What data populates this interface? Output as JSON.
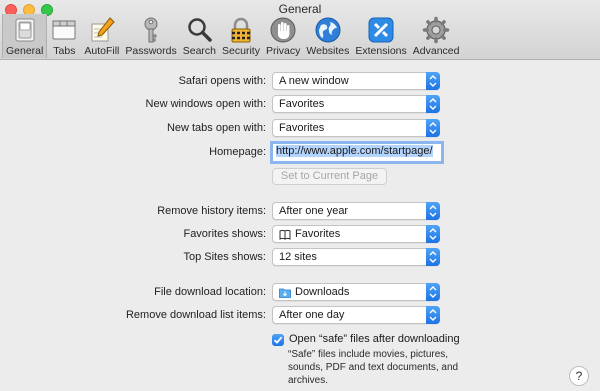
{
  "window": {
    "title": "General"
  },
  "toolbar": {
    "tabs": [
      {
        "label": "General",
        "icon": "general-switch-icon",
        "selected": true
      },
      {
        "label": "Tabs",
        "icon": "tabs-window-icon",
        "selected": false
      },
      {
        "label": "AutoFill",
        "icon": "pencil-form-icon",
        "selected": false
      },
      {
        "label": "Passwords",
        "icon": "key-icon",
        "selected": false
      },
      {
        "label": "Search",
        "icon": "magnifier-icon",
        "selected": false
      },
      {
        "label": "Security",
        "icon": "padlock-icon",
        "selected": false
      },
      {
        "label": "Privacy",
        "icon": "hand-icon",
        "selected": false
      },
      {
        "label": "Websites",
        "icon": "globe-icon",
        "selected": false
      },
      {
        "label": "Extensions",
        "icon": "puzzle-icon",
        "selected": false
      },
      {
        "label": "Advanced",
        "icon": "gear-icon",
        "selected": false
      }
    ]
  },
  "form": {
    "safari_opens_with": {
      "label": "Safari opens with:",
      "value": "A new window"
    },
    "new_windows_open_with": {
      "label": "New windows open with:",
      "value": "Favorites"
    },
    "new_tabs_open_with": {
      "label": "New tabs open with:",
      "value": "Favorites"
    },
    "homepage": {
      "label": "Homepage:",
      "value": "http://www.apple.com/startpage/"
    },
    "set_current_page_button": "Set to Current Page",
    "remove_history": {
      "label": "Remove history items:",
      "value": "After one year"
    },
    "favorites_shows": {
      "label": "Favorites shows:",
      "value": "Favorites"
    },
    "top_sites_shows": {
      "label": "Top Sites shows:",
      "value": "12 sites"
    },
    "file_download_location": {
      "label": "File download location:",
      "value": "Downloads"
    },
    "remove_download_items": {
      "label": "Remove download list items:",
      "value": "After one day"
    },
    "open_safe_files": {
      "label": "Open “safe” files after downloading",
      "checked": true
    },
    "safe_files_note": "“Safe” files include movies, pictures, sounds, PDF and text documents, and archives."
  },
  "help": {
    "label": "?"
  },
  "colors": {
    "accent": "#1d74e4",
    "window_bg": "#ececec",
    "close": "#fc605b",
    "minimize": "#fdbc40",
    "zoom": "#34c84a"
  }
}
